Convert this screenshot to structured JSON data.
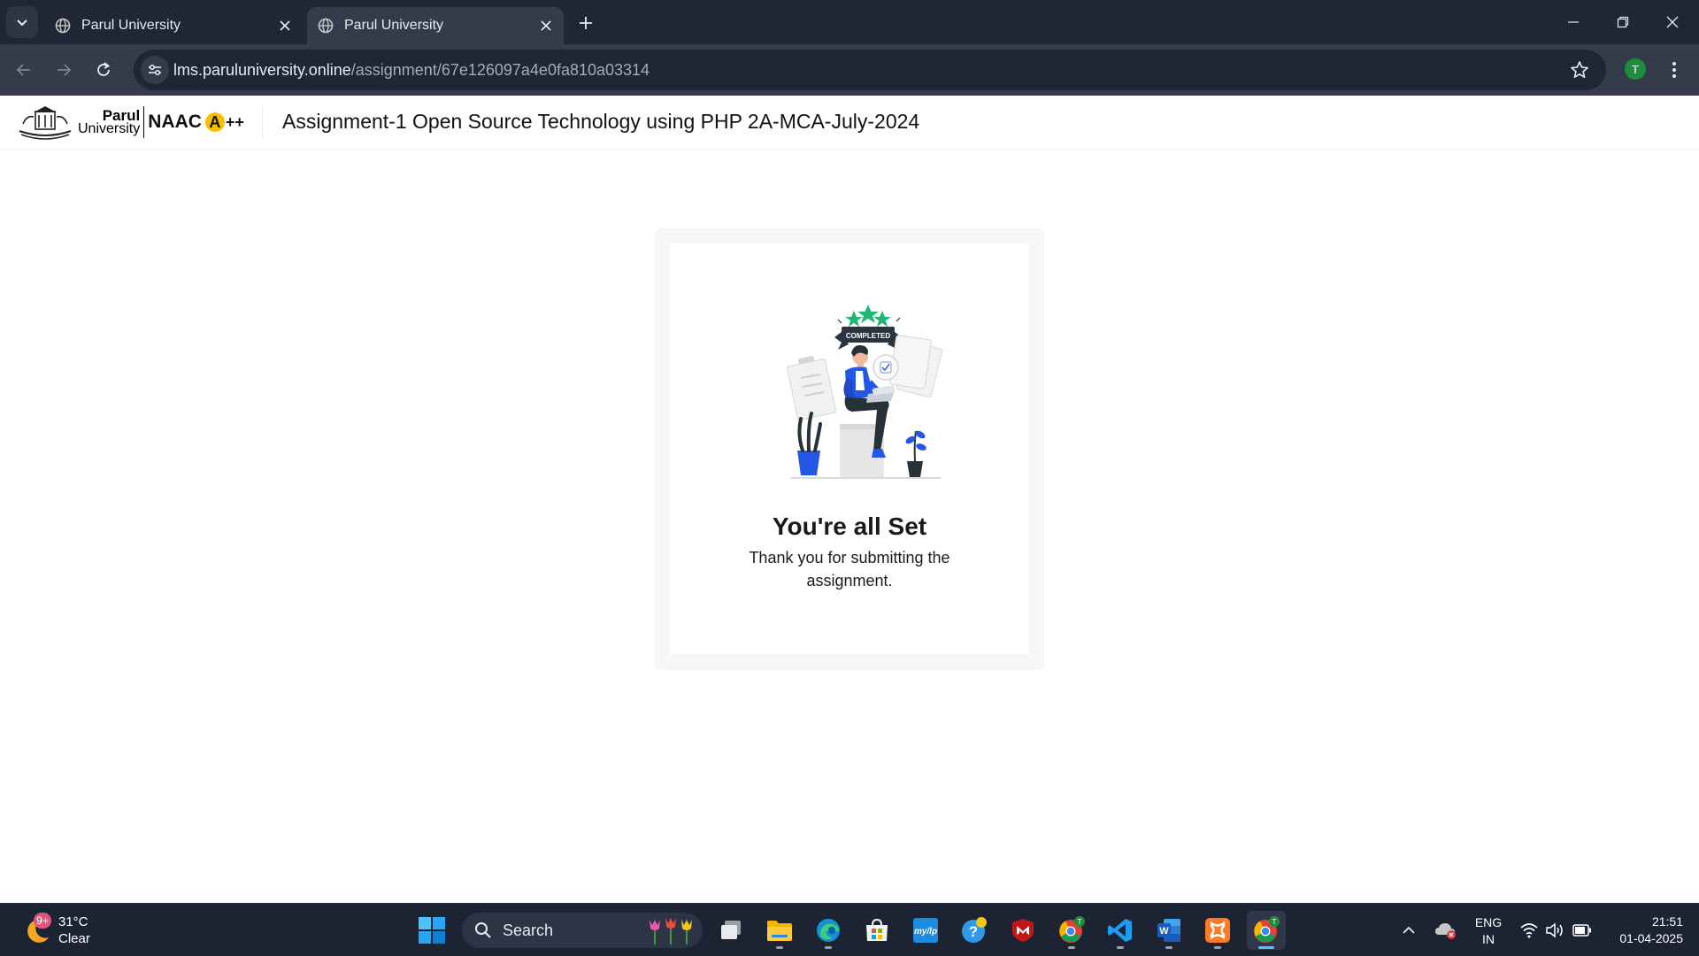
{
  "browser": {
    "tabs": [
      {
        "title": "Parul University",
        "active": false
      },
      {
        "title": "Parul University",
        "active": true
      }
    ],
    "url_host": "lms.paruluniversity.online",
    "url_path": "/assignment/67e126097a4e0fa810a03314",
    "profile_initial": "T"
  },
  "header": {
    "logo_name": "Parul",
    "logo_sub": "University",
    "naac": "NAAC",
    "naac_grade": "A",
    "naac_plus": "++",
    "page_title": "Assignment-1 Open Source Technology using PHP 2A-MCA-July-2024"
  },
  "completion": {
    "ribbon_text": "COMPLETED",
    "title": "You're all Set",
    "message": "Thank you for submitting the assignment."
  },
  "taskbar": {
    "weather_badge": "9+",
    "temperature": "31°C",
    "condition": "Clear",
    "search_label": "Search",
    "apps": [
      "task-view",
      "file-explorer",
      "edge",
      "microsoft-store",
      "mylp",
      "help",
      "mcafee",
      "chrome-profile",
      "vscode",
      "word",
      "xampp",
      "chrome"
    ],
    "lang_1": "ENG",
    "lang_2": "IN",
    "time": "21:51",
    "date": "01-04-2025"
  },
  "colors": {
    "chrome_dark": "#1f2636",
    "chrome_toolbar": "#343c4c",
    "accent_blue": "#2557e6",
    "accent_green": "#22b573",
    "taskbar": "#1c2433"
  }
}
